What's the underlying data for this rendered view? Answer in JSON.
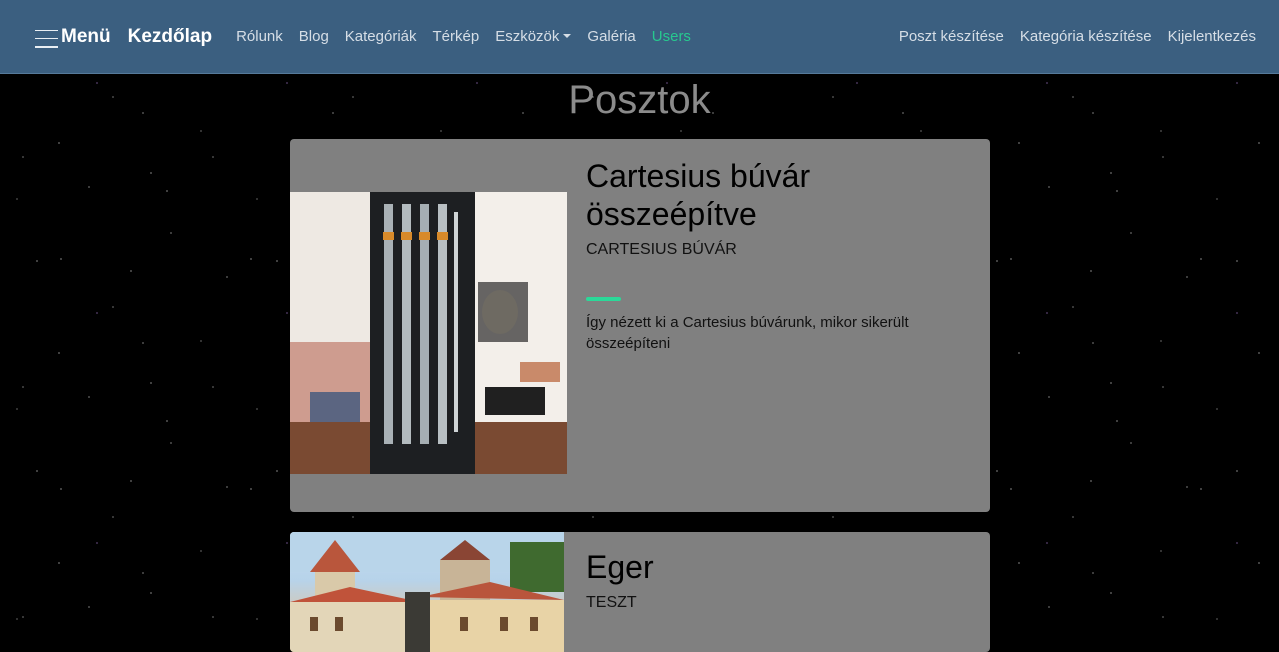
{
  "navbar": {
    "menu_label": "Menü",
    "home_label": "Kezdőlap",
    "links": [
      "Rólunk",
      "Blog",
      "Kategóriák",
      "Térkép",
      "Eszközök",
      "Galéria",
      "Users"
    ],
    "right_links": [
      "Poszt készítése",
      "Kategória készítése",
      "Kijelentkezés"
    ],
    "active_color": "#27c98f",
    "background": "#3b5f80"
  },
  "page": {
    "title": "Posztok"
  },
  "posts": [
    {
      "title": "Cartesius búvár összeépítve",
      "category": "CARTESIUS BÚVÁR",
      "excerpt": "Így nézett ki a Cartesius búvárunk, mikor sikerült összeépíteni"
    },
    {
      "title": "Eger",
      "category": "TESZT"
    }
  ],
  "colors": {
    "card": "#808080",
    "accent": "#2bd999"
  }
}
